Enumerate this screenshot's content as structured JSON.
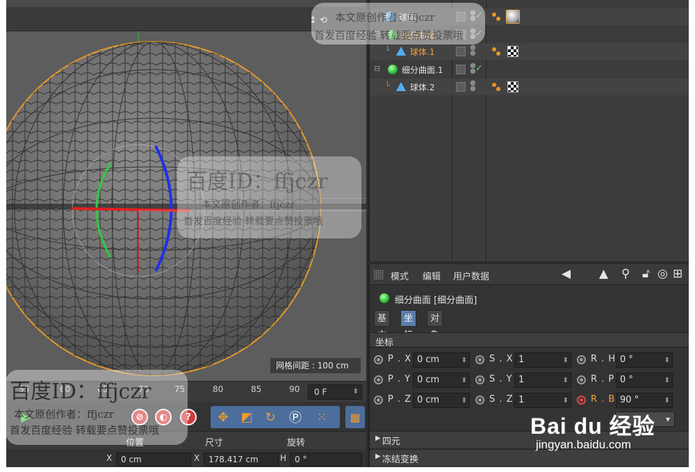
{
  "viewport": {
    "grid_spacing": "网格间距 : 100 cm",
    "nav_hint": "↕ ⟲"
  },
  "timeline": {
    "ticks": [
      "55",
      "60",
      "65",
      "70",
      "75",
      "80",
      "85",
      "90"
    ],
    "current_frame": "0 F"
  },
  "coord_manager": {
    "headers": [
      "位置",
      "尺寸",
      "旋转"
    ],
    "x_label": "X",
    "x_value": "0 cm",
    "size_x_label": "X",
    "size_x_value": "178.417 cm",
    "rot_h_label": "H",
    "rot_h_value": "0 °"
  },
  "object_manager": {
    "rows": [
      {
        "name": "球体",
        "type": "sphere"
      },
      {
        "name": "细分曲面",
        "type": "subdivision",
        "selected": true
      },
      {
        "name": "球体.1",
        "type": "primitive",
        "selected": true
      },
      {
        "name": "细分曲面.1",
        "type": "subdivision"
      },
      {
        "name": "球体.2",
        "type": "primitive"
      }
    ]
  },
  "attribute_manager": {
    "menu": [
      "模式",
      "编辑",
      "用户数据"
    ],
    "object_title": "细分曲面 [细分曲面]",
    "tabs": [
      "基本",
      "坐标",
      "对象"
    ],
    "active_tab": "坐标",
    "section": "坐标",
    "rows": [
      {
        "p_label": "P . X",
        "p_value": "0 cm",
        "s_label": "S . X",
        "s_value": "1",
        "r_label": "R . H",
        "r_value": "0 °"
      },
      {
        "p_label": "P . Y",
        "p_value": "0 cm",
        "s_label": "S . Y",
        "s_value": "1",
        "r_label": "R . P",
        "r_value": "0 °"
      },
      {
        "p_label": "P . Z",
        "p_value": "0 cm",
        "s_label": "S . Z",
        "s_value": "1",
        "r_label": "R . B",
        "r_value": "90 °"
      }
    ],
    "folds": [
      "四元",
      "冻结变换"
    ]
  },
  "watermarks": {
    "id_text": "百度ID：ffjczr",
    "line1": "本文原创作者：ffjczr",
    "line2": "首发百度经验 转载要点赞投票哦",
    "brand": "Bai du 经验",
    "url": "jingyan.baidu.com"
  },
  "colors": {
    "accent_blue": "#5a7dab",
    "selected_orange": "#f2a33a",
    "axis_red": "#e02020",
    "axis_green": "#2ecc40",
    "axis_blue": "#2030e8"
  }
}
